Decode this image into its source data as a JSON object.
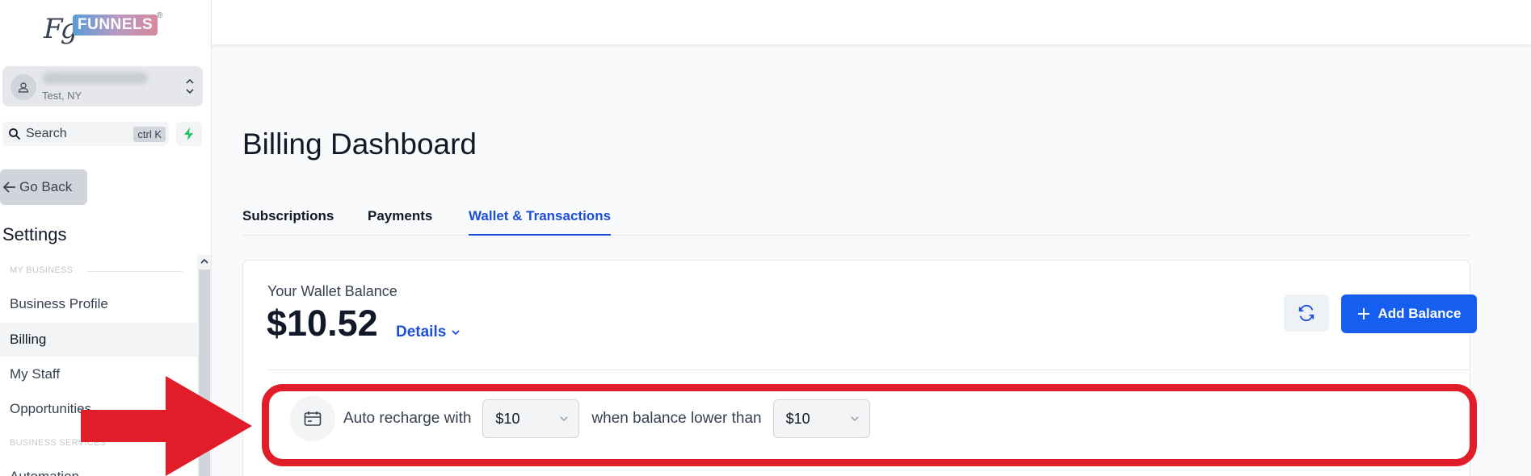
{
  "brand": {
    "logo_script": "Fg",
    "logo_word": "FUNNELS",
    "logo_mark": "®"
  },
  "location": {
    "city": "Test, NY"
  },
  "search": {
    "label": "Search",
    "shortcut": "ctrl K"
  },
  "nav": {
    "go_back": "Go Back",
    "settings_title": "Settings",
    "section_my_business": "MY BUSINESS",
    "section_business_services": "BUSINESS SERVICES",
    "items": [
      {
        "label": "Business Profile",
        "active": false
      },
      {
        "label": "Billing",
        "active": true
      },
      {
        "label": "My Staff",
        "active": false
      },
      {
        "label": "Opportunities",
        "active": false
      },
      {
        "label": "Automation",
        "active": false
      }
    ]
  },
  "page": {
    "title": "Billing Dashboard",
    "tabs": [
      {
        "label": "Subscriptions",
        "active": false
      },
      {
        "label": "Payments",
        "active": false
      },
      {
        "label": "Wallet & Transactions",
        "active": true
      }
    ]
  },
  "wallet": {
    "label": "Your Wallet Balance",
    "amount": "$10.52",
    "details_label": "Details",
    "add_balance_label": "Add Balance"
  },
  "auto_recharge": {
    "text_prefix": "Auto recharge with",
    "amount_value": "$10",
    "text_middle": "when balance lower than",
    "threshold_value": "$10"
  },
  "colors": {
    "accent": "#155eef",
    "highlight": "#e11d2a",
    "bolt": "#22c55e"
  }
}
